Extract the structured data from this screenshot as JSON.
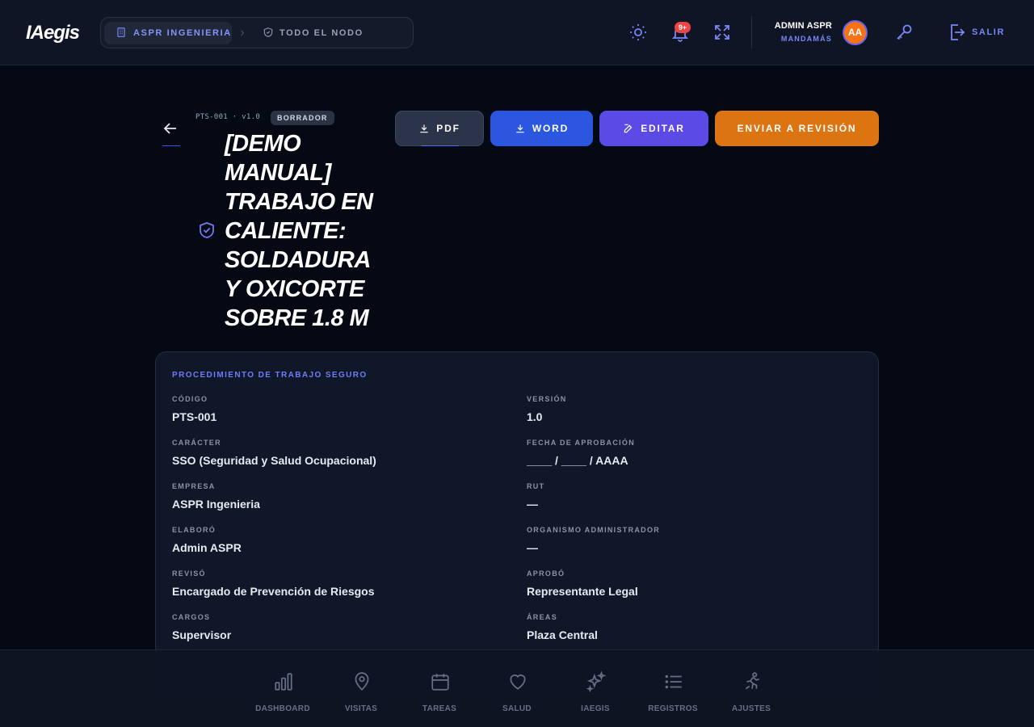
{
  "header": {
    "logo": "IAegis",
    "breadcrumb": [
      {
        "label": "ASPR INGENIERIA",
        "icon": "building-icon"
      },
      {
        "label": "TODO EL NODO",
        "icon": "shield-icon"
      }
    ],
    "notifications_count": "9+",
    "user_name": "ADMIN ASPR",
    "user_role": "MANDAMÁS",
    "avatar_initials": "AA",
    "logout_label": "SALIR"
  },
  "document": {
    "code_version": "PTS-001 · v1.0",
    "status": "BORRADOR",
    "title": "[DEMO MANUAL] TRABAJO EN CALIENTE: SOLDADURA Y OXICORTE SOBRE 1.8 M"
  },
  "actions": {
    "pdf": "PDF",
    "word": "WORD",
    "edit": "EDITAR",
    "send": "ENVIAR A REVISIÓN"
  },
  "card": {
    "title": "PROCEDIMIENTO DE TRABAJO SEGURO",
    "fields": [
      {
        "label": "CÓDIGO",
        "value": "PTS-001"
      },
      {
        "label": "VERSIÓN",
        "value": "1.0"
      },
      {
        "label": "CARÁCTER",
        "value": "SSO (Seguridad y Salud Ocupacional)"
      },
      {
        "label": "FECHA DE APROBACIÓN",
        "value": "____ / ____ / AAAA"
      },
      {
        "label": "EMPRESA",
        "value": "ASPR Ingenieria"
      },
      {
        "label": "RUT",
        "value": "—"
      },
      {
        "label": "ELABORÓ",
        "value": "Admin ASPR"
      },
      {
        "label": "ORGANISMO ADMINISTRADOR",
        "value": "—"
      },
      {
        "label": "REVISÓ",
        "value": "Encargado de Prevención de Riesgos"
      },
      {
        "label": "APROBÓ",
        "value": "Representante Legal"
      },
      {
        "label": "CARGOS",
        "value": "Supervisor"
      },
      {
        "label": "ÁREAS",
        "value": "Plaza Central"
      }
    ]
  },
  "bottom_nav": [
    {
      "label": "DASHBOARD",
      "icon": "bar-chart-icon"
    },
    {
      "label": "VISITAS",
      "icon": "map-pin-icon"
    },
    {
      "label": "TAREAS",
      "icon": "calendar-icon"
    },
    {
      "label": "SALUD",
      "icon": "heart-icon"
    },
    {
      "label": "IAEGIS",
      "icon": "sparkles-icon"
    },
    {
      "label": "REGISTROS",
      "icon": "list-icon"
    },
    {
      "label": "AJUSTES",
      "icon": "runner-icon"
    }
  ],
  "colors": {
    "accent": "#6f7cf7",
    "word": "#2a56e0",
    "edit": "#5b4ae6",
    "send": "#dd7412",
    "badge": "#ef4444",
    "avatar": "#f97316"
  }
}
